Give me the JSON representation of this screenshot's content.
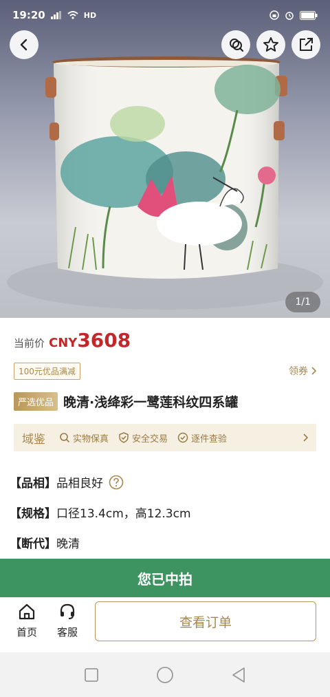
{
  "status_bar": {
    "time": "19:20",
    "network": "HD"
  },
  "image": {
    "counter": "1/1"
  },
  "price": {
    "label": "当前价",
    "currency": "CNY",
    "value": "3608"
  },
  "coupon": {
    "tag": "100元优品满减",
    "link": "领券"
  },
  "title": {
    "badge": "严选优品",
    "text": "晚清·浅绛彩一鹭莲科纹四系罐"
  },
  "assurance": {
    "brand": "域鉴",
    "items": [
      "实物保真",
      "安全交易",
      "逐件查验"
    ]
  },
  "specs": [
    {
      "key": "【品相】",
      "value": "品相良好"
    },
    {
      "key": "【规格】",
      "value": "口径13.4cm，高12.3cm"
    },
    {
      "key": "【断代】",
      "value": "晚清"
    }
  ],
  "status_banner": "您已中拍",
  "bottom_nav": {
    "home": "首页",
    "service": "客服",
    "order_button": "查看订单"
  },
  "icons": [
    "back-icon",
    "share-search-icon",
    "star-icon",
    "share-icon",
    "help-icon",
    "home-icon",
    "headset-icon"
  ],
  "colors": {
    "price": "#c4272a",
    "gold": "#a8874e",
    "won": "#3d9460"
  }
}
